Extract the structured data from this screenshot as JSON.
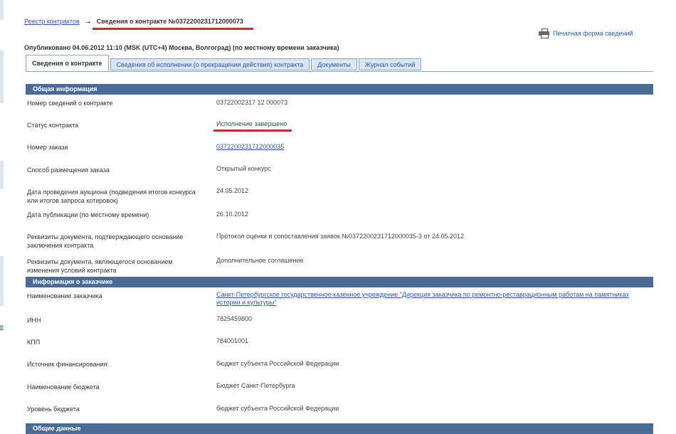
{
  "breadcrumb": {
    "parent": "Реестр контрактов",
    "arrow": "→",
    "current": "Сведения о контракте №0372200231712000073"
  },
  "print_link": "Печатная форма сведений",
  "published": "Опубликовано 04.06.2012 11:10 (MSK (UTC+4) Москва, Волгоград) (по местному времени заказчика)",
  "tabs": [
    {
      "label": "Сведения о контракте",
      "active": true
    },
    {
      "label": "Сведения об исполнении (о прекращении действия) контракта",
      "active": false
    },
    {
      "label": "Документы",
      "active": false
    },
    {
      "label": "Журнал событий",
      "active": false
    }
  ],
  "sections": {
    "general": {
      "title": "Общая информация",
      "rows": [
        {
          "label": "Номер сведений о контракте",
          "value": "03722002317 12 000073"
        },
        {
          "label": "Статус контракта",
          "value": "Исполнение завершено"
        },
        {
          "label": "Номер заказа",
          "value": "0372200231712000035"
        },
        {
          "label": "Способ размещения заказа",
          "value": "Открытый конкурс"
        },
        {
          "label": "Дата проведения аукциона (подведения итогов конкурса или итогов запроса котировок)",
          "value": "24.05.2012"
        },
        {
          "label": "Дата публикации (по местному времени)",
          "value": "26.10.2012"
        },
        {
          "label": "Реквизиты документа, подтверждающего основание заключения контракта",
          "value": "Протокол оценки и сопоставления заявок №0372200231712000035-3 от 24.05.2012"
        },
        {
          "label": "Реквизиты документа, являющегося основанием изменения условий контракта",
          "value": "Дополнительное соглашение"
        }
      ]
    },
    "customer": {
      "title": "Информация о заказчике",
      "rows": [
        {
          "label": "Наименование заказчика",
          "value": "Санкт-Петербургское государственное казенное учреждение \"Дирекция заказчика по ремонтно-реставрационным работам на памятниках истории и культуры\""
        },
        {
          "label": "ИНН",
          "value": "7825459800"
        },
        {
          "label": "КПП",
          "value": "784001001"
        },
        {
          "label": "Источник финансирования:",
          "value": "бюджет субъекта Российской Федерации"
        },
        {
          "label": "Наименование бюджета",
          "value": "Бюджет Санкт-Петербурга"
        },
        {
          "label": "Уровень бюджета",
          "value": "бюджет субъекта Российской Федерации"
        }
      ]
    },
    "common": {
      "title": "Общие данные"
    }
  },
  "left_strip_link": "в",
  "colors": {
    "section_header": "#4a6b95",
    "link": "#2a5aa8",
    "highlight_underline": "#d12b2b"
  }
}
